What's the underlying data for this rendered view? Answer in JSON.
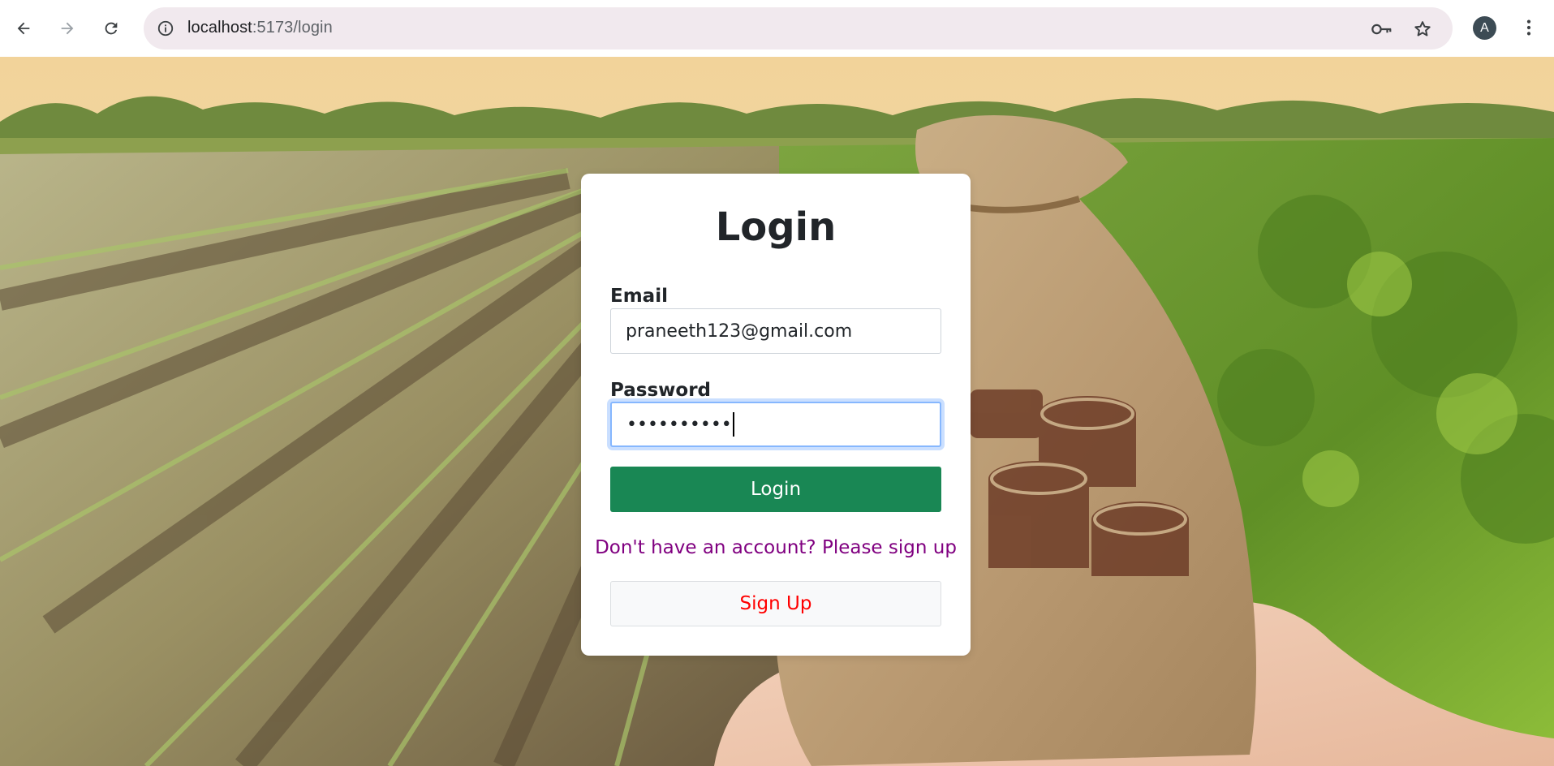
{
  "browser": {
    "url_host": "localhost",
    "url_path": ":5173/login",
    "avatar_letter": "A"
  },
  "login": {
    "title": "Login",
    "email_label": "Email",
    "email_value": "praneeth123@gmail.com",
    "password_label": "Password",
    "password_mask": "••••••••••",
    "login_button": "Login",
    "signup_prompt": "Don't have an account? Please sign up",
    "signup_button": "Sign Up"
  },
  "colors": {
    "login_button": "#198754",
    "signup_prompt": "#800080",
    "signup_button_text": "#ff0000",
    "focus_ring": "#86b7fe"
  }
}
